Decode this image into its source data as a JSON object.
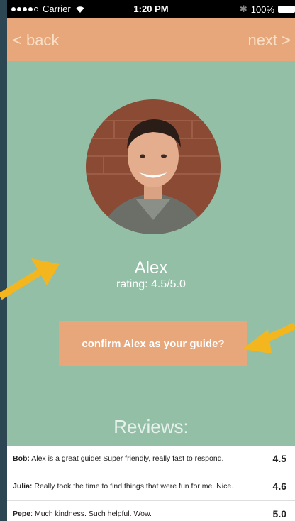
{
  "status_bar": {
    "carrier": "Carrier",
    "time": "1:20 PM",
    "battery": "100%"
  },
  "nav": {
    "back_label": "< back",
    "next_label": "next >"
  },
  "guide": {
    "name": "Alex",
    "rating": "rating: 4.5/5.0"
  },
  "confirm_label": "confirm Alex as your guide?",
  "reviews_title": "Reviews:",
  "reviews": [
    {
      "author": "Bob:",
      "text": " Alex is a great guide! Super friendly, really fast to respond.",
      "score": "4.5"
    },
    {
      "author": "Julia:",
      "text": " Really took the time to find things that were fun for me. Nice.",
      "score": "4.6"
    },
    {
      "author": "Pepe",
      "text": ": Much kindness. Such helpful. Wow.",
      "score": "5.0"
    }
  ],
  "colors": {
    "background": "#94bfa7",
    "accent": "#e8a77a",
    "arrow": "#f3b61f"
  }
}
